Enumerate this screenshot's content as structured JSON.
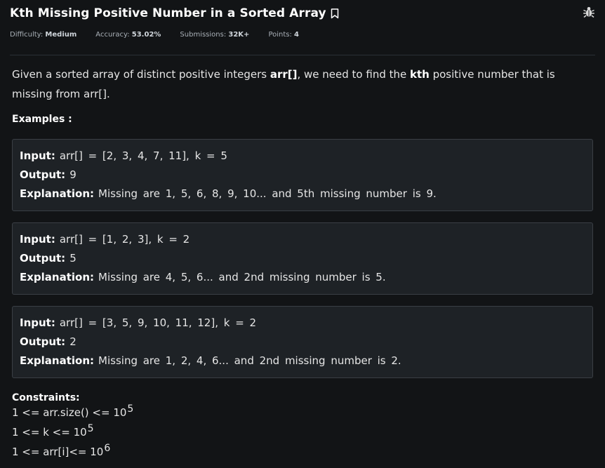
{
  "header": {
    "title": "Kth Missing Positive Number in a Sorted Array",
    "bookmark_icon": "bookmark-icon",
    "bug_icon": "bug-icon",
    "meta": [
      {
        "label": "Difficulty: ",
        "value": "Medium"
      },
      {
        "label": "Accuracy: ",
        "value": "53.02%"
      },
      {
        "label": "Submissions: ",
        "value": "32K+"
      },
      {
        "label": "Points: ",
        "value": "4"
      }
    ]
  },
  "description": {
    "part1": "Given a sorted array of distinct positive integers ",
    "bold1": "arr[]",
    "part2": ", we need to find the ",
    "bold2": "kth",
    "part3": " positive number that is missing from arr[]."
  },
  "examples_title": "Examples :",
  "examples": [
    {
      "input_label": "Input:",
      "input_value": "arr[] = [2, 3, 4, 7, 11], k = 5",
      "output_label": "Output:",
      "output_value": "9",
      "explanation_label": "Explanation:",
      "explanation_value": "Missing are 1, 5, 6, 8, 9, 10... and 5th missing number is 9."
    },
    {
      "input_label": "Input:",
      "input_value": "arr[] = [1, 2, 3], k = 2",
      "output_label": "Output:",
      "output_value": "5",
      "explanation_label": "Explanation:",
      "explanation_value": "Missing are 4, 5, 6... and 2nd missing number is 5."
    },
    {
      "input_label": "Input:",
      "input_value": "arr[] = [3, 5, 9, 10, 11, 12], k = 2",
      "output_label": "Output:",
      "output_value": "2",
      "explanation_label": "Explanation:",
      "explanation_value": "Missing are 1, 2, 4, 6... and 2nd missing number is 2."
    }
  ],
  "constraints_title": "Constraints:",
  "constraints": [
    {
      "text": "1 <= arr.size() <= 10",
      "exp": "5"
    },
    {
      "text": "1 <= k <= 10",
      "exp": "5"
    },
    {
      "text": "1 <= arr[i]<= 10",
      "exp": "6"
    }
  ]
}
